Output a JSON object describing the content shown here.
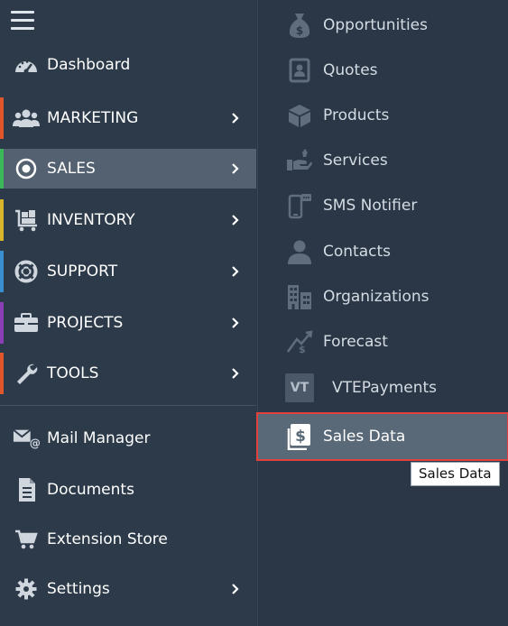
{
  "left_menu": {
    "items": [
      {
        "label": "Dashboard",
        "icon": "dashboard-icon"
      },
      {
        "label": "MARKETING",
        "icon": "users-icon",
        "accent": "#e2562b"
      },
      {
        "label": "SALES",
        "icon": "target-icon",
        "accent": "#3cb85a"
      },
      {
        "label": "INVENTORY",
        "icon": "cart-icon",
        "accent": "#d8b52a"
      },
      {
        "label": "SUPPORT",
        "icon": "lifebuoy-icon",
        "accent": "#3a8fd1"
      },
      {
        "label": "PROJECTS",
        "icon": "briefcase-icon",
        "accent": "#8a3fb6"
      },
      {
        "label": "TOOLS",
        "icon": "wrench-icon",
        "accent": "#e2562b"
      },
      {
        "label": "Mail Manager",
        "icon": "mail-icon"
      },
      {
        "label": "Documents",
        "icon": "document-icon"
      },
      {
        "label": "Extension Store",
        "icon": "shopping-cart-icon"
      },
      {
        "label": "Settings",
        "icon": "gear-icon"
      }
    ]
  },
  "sales_submenu": {
    "items": [
      {
        "label": "Opportunities",
        "icon": "money-bag-icon"
      },
      {
        "label": "Quotes",
        "icon": "quote-icon"
      },
      {
        "label": "Products",
        "icon": "cube-icon"
      },
      {
        "label": "Services",
        "icon": "handshake-icon"
      },
      {
        "label": "SMS Notifier",
        "icon": "phone-icon"
      },
      {
        "label": "Contacts",
        "icon": "person-icon"
      },
      {
        "label": "Organizations",
        "icon": "building-icon"
      },
      {
        "label": "Forecast",
        "icon": "forecast-icon"
      },
      {
        "label": "VTEPayments",
        "icon": "vt-badge-icon",
        "badge": "VT"
      },
      {
        "label": "Sales Data",
        "icon": "dollar-doc-icon"
      }
    ]
  },
  "tooltip": {
    "text": "Sales Data"
  },
  "colors": {
    "left_bg": "#2c3a49",
    "right_bg": "#2b3746",
    "active_bg": "#536170",
    "selected_outline": "#e0413e"
  }
}
